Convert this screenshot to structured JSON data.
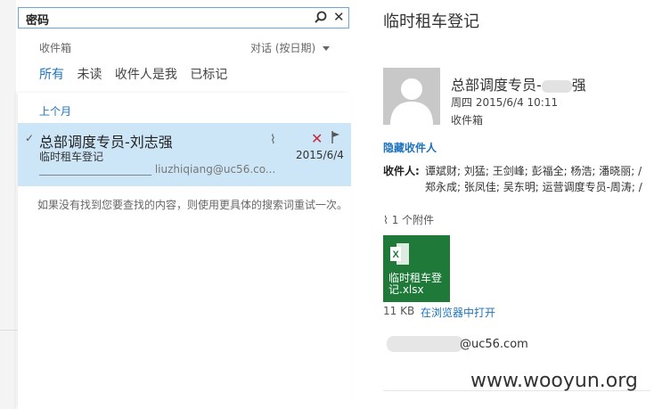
{
  "search": {
    "value": "密码"
  },
  "list": {
    "folder": "收件箱",
    "sort_label": "对话 (按日期)",
    "filters": [
      "所有",
      "未读",
      "收件人是我",
      "已标记"
    ],
    "group_label": "上个月",
    "message": {
      "sender": "总部调度专员-刘志强",
      "subject": "临时租车登记",
      "date": "2015/6/4",
      "preview": "_____________________ liuzhiqiang@uc56.co..."
    },
    "no_result_text": "如果没有找到您要查找的内容，则使用更具体的搜索词重试一次。"
  },
  "reading": {
    "title": "临时租车登记",
    "from_prefix": "总部调度专员-",
    "from_suffix": "强",
    "datetime": "周四 2015/6/4 10:11",
    "folder": "收件箱",
    "hide_recipients": "隐藏收件人",
    "recipients_label": "收件人:",
    "recipients_line1": "谭斌财; 刘猛; 王剑峰; 彭福全; 杨浩; 潘晓丽; /",
    "recipients_line2": "郑永成; 张凤佳; 吴东明; 运营调度专员-周涛; /",
    "attachment_count": "1 个附件",
    "attachment_name": "临时租车登记.xlsx",
    "attachment_size": "11 KB",
    "attachment_open": "在浏览器中打开",
    "email_domain": "@uc56.com"
  },
  "watermark": "www.wooyun.org",
  "colors": {
    "accent": "#1e73be",
    "selected": "#cde6f7",
    "excel": "#1f7a3a",
    "delete": "#c5283d"
  }
}
